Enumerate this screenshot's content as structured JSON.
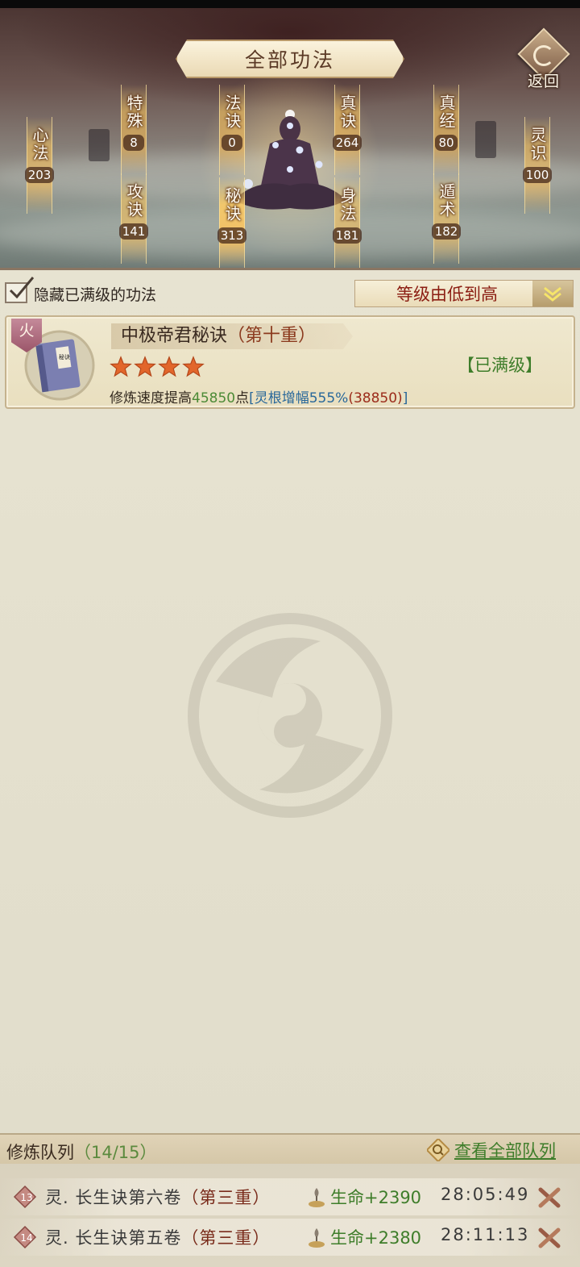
{
  "header": {
    "title": "全部功法",
    "back_label": "返回"
  },
  "categories": [
    {
      "name": "心法",
      "count": "203"
    },
    {
      "name": "特殊",
      "count": "8"
    },
    {
      "name": "攻诀",
      "count": "141"
    },
    {
      "name": "法诀",
      "count": "0"
    },
    {
      "name": "秘诀",
      "count": "313"
    },
    {
      "name": "真诀",
      "count": "264"
    },
    {
      "name": "身法",
      "count": "181"
    },
    {
      "name": "真经",
      "count": "80"
    },
    {
      "name": "遁术",
      "count": "182"
    },
    {
      "name": "灵识",
      "count": "100"
    }
  ],
  "filter": {
    "hide_maxed_label": "隐藏已满级的功法",
    "hide_maxed_checked": true,
    "sort_value": "等级由低到高"
  },
  "skills": [
    {
      "element": "火",
      "book_label": "秘诀",
      "name": "中极帝君秘诀",
      "tier": "（第十重）",
      "stars": 4,
      "status": "【已满级】",
      "effect_prefix": "修炼速度提高",
      "effect_value": "45850",
      "effect_unit": "点",
      "bonus_label": "[灵根增幅555%",
      "bonus_value": "(38850)",
      "bonus_close": "]"
    }
  ],
  "queue": {
    "title": "修炼队列",
    "count": "（14/15）",
    "view_all": "查看全部队列",
    "items": [
      {
        "index": "13",
        "name": "灵. 长生诀第六卷",
        "tier": "（第三重）",
        "effect": "生命+2390",
        "time": "28:05:49"
      },
      {
        "index": "14",
        "name": "灵. 长生诀第五卷",
        "tier": "（第三重）",
        "effect": "生命+2380",
        "time": "28:11:13"
      }
    ]
  },
  "colors": {
    "accent_red": "#8b1d12",
    "accent_green": "#3e7d2a",
    "accent_blue": "#28679a",
    "star": "#e2662b"
  }
}
